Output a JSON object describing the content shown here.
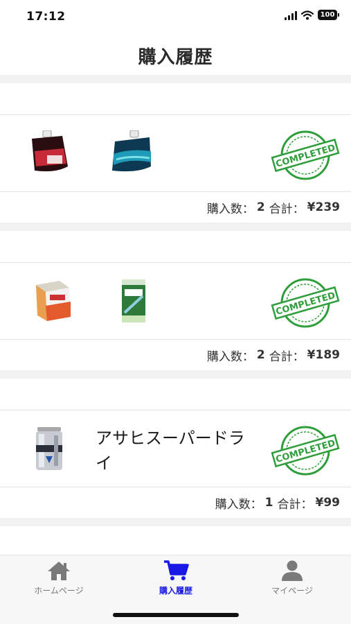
{
  "status": {
    "time": "17:12",
    "battery": "100"
  },
  "header": {
    "title": "購入履歴"
  },
  "stamp_text": "COMPLETED",
  "orders": [
    {
      "products": [
        "pouch-drink-red",
        "pouch-drink-blue"
      ],
      "name": "",
      "count_label": "購入数：",
      "count": "2",
      "total_label": "合計：",
      "total": "¥239"
    },
    {
      "products": [
        "juice-carton-orange",
        "tea-carton-green"
      ],
      "name": "",
      "count_label": "購入数：",
      "count": "2",
      "total_label": "合計：",
      "total": "¥189"
    },
    {
      "products": [
        "beer-can-asahi"
      ],
      "name": "アサヒスーパードライ",
      "count_label": "購入数：",
      "count": "1",
      "total_label": "合計：",
      "total": "¥99"
    }
  ],
  "tabs": [
    {
      "label": "ホームページ",
      "icon": "home-icon",
      "active": false
    },
    {
      "label": "購入履歴",
      "icon": "cart-icon",
      "active": true
    },
    {
      "label": "マイページ",
      "icon": "user-icon",
      "active": false
    }
  ],
  "colors": {
    "accent": "#1919e6",
    "stamp": "#2e9e3a",
    "inactive_icon": "#7a7a7a"
  }
}
